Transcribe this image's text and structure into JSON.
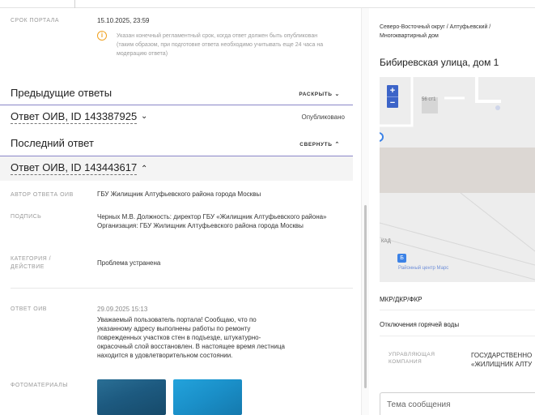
{
  "deadline": {
    "label": "СРОК ПОРТАЛА",
    "value": "15.10.2025, 23:59",
    "warning": "Указан конечный регламентный срок, когда ответ должен быть опубликован (таким образом, при подготовке ответа необходимо учитывать еще 24 часа на модерацию ответа)"
  },
  "previous": {
    "title": "Предыдущие ответы",
    "action": "РАСКРЫТЬ",
    "answer_title": "Ответ ОИВ, ID 143387925",
    "answer_status": "Опубликовано"
  },
  "last": {
    "title": "Последний ответ",
    "action": "СВЕРНУТЬ",
    "answer_title": "Ответ ОИВ, ID 143443617"
  },
  "details": {
    "author_label": "АВТОР ОТВЕТА ОИВ",
    "author_value": "ГБУ Жилищник Алтуфьевского района города Москвы",
    "signature_label": "ПОДПИСЬ",
    "signature_value": "Черных М.В. Должность: директор ГБУ «Жилищник Алтуфьевского района» Организация: ГБУ Жилищник Алтуфьевского района города Москвы",
    "category_label_1": "КАТЕГОРИЯ /",
    "category_label_2": "ДЕЙСТВИЕ",
    "category_value": "Проблема устранена",
    "answer_label": "ОТВЕТ ОИВ",
    "answer_date": "29.09.2025 15:13",
    "answer_text": "Уважаемый пользователь портала! Сообщаю, что по указанному адресу выполнены работы по ремонту поврежденных участков стен в подъезде, штукатурно-окрасочный слой восстановлен. В настоящее время лестница находится в удовлетворительном состоянии.",
    "photos_label": "ФОТОМАТЕРИАЛЫ"
  },
  "side": {
    "breadcrumb": "Северо-Восточный округ / Алтуфьевский / Многоквартирный дом",
    "address": "Бибиревская улица, дом 1",
    "map": {
      "zoom_in": "+",
      "zoom_out": "−",
      "building_label": "56 ст1",
      "road_label": "КАД",
      "poi_glyph": "Б",
      "poi_label": "Районный центр Марс"
    },
    "link_1": "МКР/ДКР/ФКР",
    "link_2": "Отключения горячей воды",
    "uk_label_1": "УПРАВЛЯЮЩАЯ",
    "uk_label_2": "КОМПАНИЯ",
    "uk_value_1": "ГОСУДАРСТВЕННО",
    "uk_value_2": "«ЖИЛИЩНИК АЛТУ",
    "message_placeholder": "Тема сообщения"
  },
  "colors": {
    "accent_line": "#8a86c8",
    "map_control": "#3c64c8",
    "warning": "#f0a01e",
    "photo_1": "#1f5f86",
    "photo_2": "#1a8fc8"
  }
}
